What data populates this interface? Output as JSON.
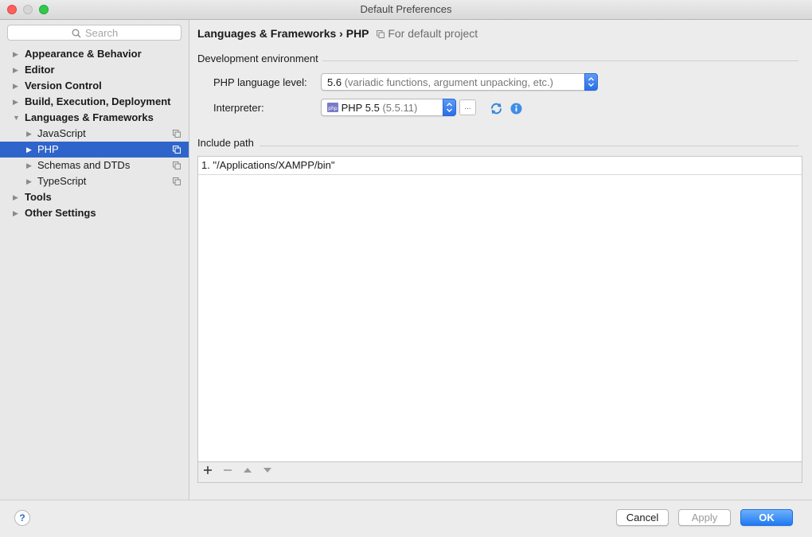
{
  "window": {
    "title": "Default Preferences"
  },
  "sidebar": {
    "search_placeholder": "Search",
    "items": [
      {
        "label": "Appearance & Behavior"
      },
      {
        "label": "Editor"
      },
      {
        "label": "Version Control"
      },
      {
        "label": "Build, Execution, Deployment"
      },
      {
        "label": "Languages & Frameworks"
      },
      {
        "label": "JavaScript"
      },
      {
        "label": "PHP"
      },
      {
        "label": "Schemas and DTDs"
      },
      {
        "label": "TypeScript"
      },
      {
        "label": "Tools"
      },
      {
        "label": "Other Settings"
      }
    ]
  },
  "breadcrumb": {
    "section": "Languages & Frameworks",
    "separator": "›",
    "page": "PHP",
    "scope": "For default project"
  },
  "dev_env": {
    "title": "Development environment",
    "language_level_label": "PHP language level:",
    "language_level_value": "5.6",
    "language_level_hint": "(variadic functions, argument unpacking, etc.)",
    "interpreter_label": "Interpreter:",
    "interpreter_value": "PHP 5.5",
    "interpreter_version": "(5.5.11)",
    "browse_label": "..."
  },
  "include_path": {
    "title": "Include path",
    "entries": [
      "1. \"/Applications/XAMPP/bin\""
    ]
  },
  "buttons": {
    "help": "?",
    "cancel": "Cancel",
    "apply": "Apply",
    "ok": "OK"
  },
  "colors": {
    "selection": "#2f65ca",
    "primary_button": "#1f7af3",
    "close": "#fc605c",
    "maximize": "#34c84a"
  },
  "icons": [
    "search-icon",
    "copy-icon",
    "php-icon",
    "refresh-icon",
    "info-icon",
    "add-icon",
    "remove-icon",
    "move-up-icon",
    "move-down-icon",
    "help-icon"
  ]
}
